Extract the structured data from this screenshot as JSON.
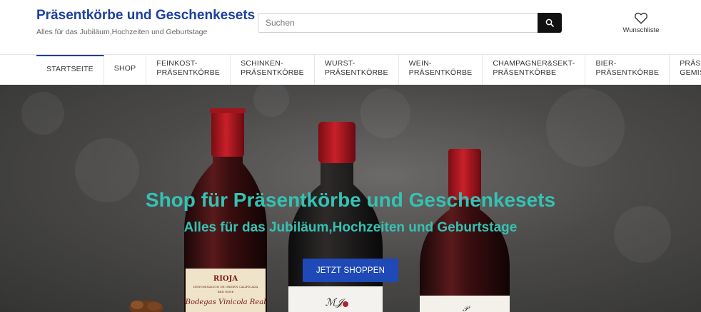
{
  "header": {
    "brand_title": "Präsentkörbe und Geschenkesets",
    "brand_subtitle": "Alles für das Jubiläum,Hochzeiten und Geburtstage",
    "search_placeholder": "Suchen",
    "search_icon": "search-icon",
    "wishlist_icon": "heart-icon",
    "wishlist_label": "Wunschliste"
  },
  "nav": {
    "items": [
      {
        "line1": "STARTSEITE",
        "line2": ""
      },
      {
        "line1": "SHOP",
        "line2": ""
      },
      {
        "line1": "FEINKOST-",
        "line2": "PRÄSENTKÖRBE"
      },
      {
        "line1": "SCHINKEN-",
        "line2": "PRÄSENTKÖRBE"
      },
      {
        "line1": "WURST-",
        "line2": "PRÄSENTKÖRBE"
      },
      {
        "line1": "WEIN-",
        "line2": "PRÄSENTKÖRBE"
      },
      {
        "line1": "CHAMPAGNER&SEKT-",
        "line2": "PRÄSENTKÖRBE"
      },
      {
        "line1": "BIER-",
        "line2": "PRÄSENTKÖRBE"
      },
      {
        "line1": "PRÄSENTKÖRBE",
        "line2": "GEMISCHT"
      }
    ]
  },
  "hero": {
    "title": "Shop für Präsentkörbe und Geschenkesets",
    "subtitle": "Alles für das Jubiläum,Hochzeiten und Geburtstage",
    "cta_label": "JETZT SHOPPEN",
    "bottle_left_label_line1": "RIOJA",
    "bottle_left_label_line2": "DENOMINACION DE ORIGEN CALIFICADA",
    "bottle_left_label_line3": "RED WINE",
    "bottle_left_label_line4": "Bodegas Vinicola Real"
  },
  "colors": {
    "brand": "#1d3f9e",
    "accent_text": "#35c2b3",
    "cta": "#1f49b6",
    "search_button": "#111111"
  }
}
